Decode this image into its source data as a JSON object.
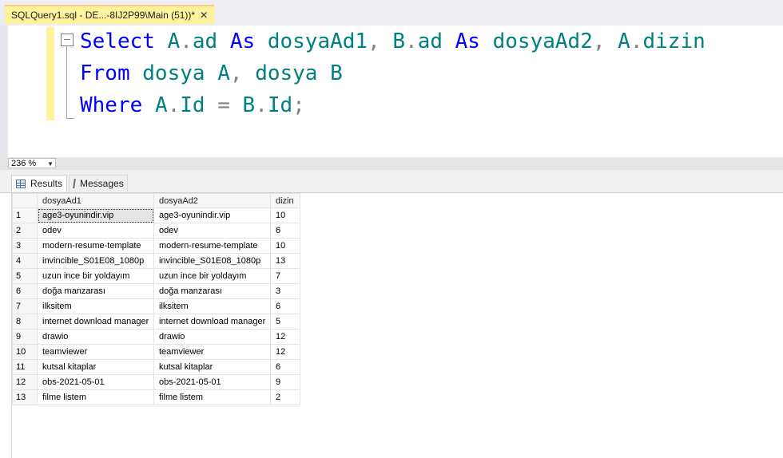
{
  "tab": {
    "title": "SQLQuery1.sql - DE...-8IJ2P99\\Main (51))*",
    "close": "✕"
  },
  "editor": {
    "line1": {
      "kw1": "Select",
      "t1": "A",
      "p1": ".",
      "t2": "ad",
      "kw2": "As",
      "t3": "dosyaAd1",
      "c1": ",",
      "t4": "B",
      "p2": ".",
      "t5": "ad",
      "kw3": "As",
      "t6": "dosyaAd2",
      "c2": ",",
      "t7": "A",
      "p3": ".",
      "t8": "dizin"
    },
    "line2": {
      "kw1": "From",
      "t1": "dosya",
      "t2": "A",
      "c1": ",",
      "t3": "dosya",
      "t4": "B"
    },
    "line3": {
      "kw1": "Where",
      "t1": "A",
      "p1": ".",
      "t2": "Id",
      "op": "=",
      "t3": "B",
      "p2": ".",
      "t4": "Id",
      "semi": ";"
    }
  },
  "zoom": {
    "value": "236 %"
  },
  "results_tabs": {
    "results": "Results",
    "messages": "Messages"
  },
  "grid": {
    "columns": [
      "dosyaAd1",
      "dosyaAd2",
      "dizin"
    ],
    "rows": [
      [
        "1",
        "age3-oyunindir.vip",
        "age3-oyunindir.vip",
        "10"
      ],
      [
        "2",
        "odev",
        "odev",
        "6"
      ],
      [
        "3",
        "modern-resume-template",
        "modern-resume-template",
        "10"
      ],
      [
        "4",
        "invincible_S01E08_1080p",
        "invincible_S01E08_1080p",
        "13"
      ],
      [
        "5",
        "uzun ince bir yoldayım",
        "uzun ince bir yoldayım",
        "7"
      ],
      [
        "6",
        "doğa manzarası",
        "doğa manzarası",
        "3"
      ],
      [
        "7",
        "ilksitem",
        "ilksitem",
        "6"
      ],
      [
        "8",
        "internet download manager",
        "internet download manager",
        "5"
      ],
      [
        "9",
        "drawio",
        "drawio",
        "12"
      ],
      [
        "10",
        "teamviewer",
        "teamviewer",
        "12"
      ],
      [
        "11",
        "kutsal kitaplar",
        "kutsal kitaplar",
        "6"
      ],
      [
        "12",
        "obs-2021-05-01",
        "obs-2021-05-01",
        "9"
      ],
      [
        "13",
        "filme listem",
        "filme listem",
        "2"
      ]
    ]
  },
  "colors": {
    "keyword": "#0000ff",
    "identifier": "#008080",
    "operator": "#808080",
    "tab": "#fff29d"
  }
}
